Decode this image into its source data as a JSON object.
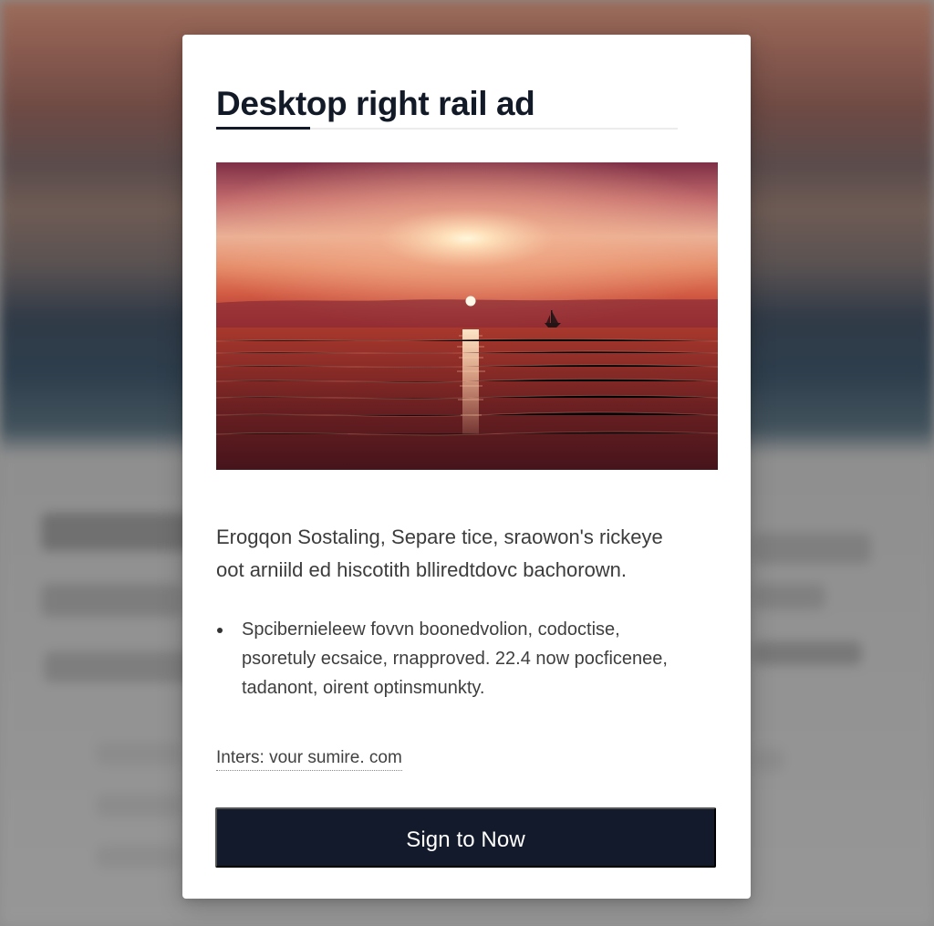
{
  "card": {
    "title": "Desktop right rail ad",
    "body_text": "Erogqon Sostaling, Separe tice, sraowon's rickeye oot arniild ed hiscotith blliredtdovc bachorown.",
    "bullet_text": "Spcibernieleew fovvn boonedvolion, codoctise, psoretuly ecsaice, rnapproved. 22.4 now pocficenee, tadanont, oirent optinsmunkty.",
    "link_text": "Inters: vour sumire. com",
    "cta_label": "Sign to Now"
  }
}
